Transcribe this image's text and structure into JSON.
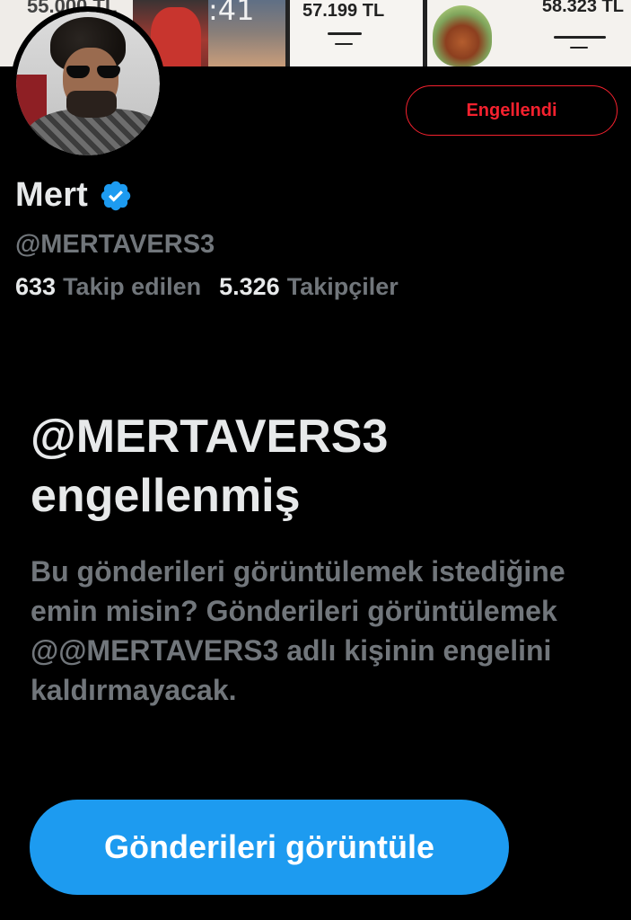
{
  "banner": {
    "price_1": "55.000 TL",
    "time_text": ":41",
    "price_2": "57.199 TL",
    "price_3": "58.323 TL"
  },
  "profile": {
    "name": "Mert",
    "verified": true,
    "verified_icon": "verified-badge-icon",
    "handle": "@MERTAVERS3",
    "following_count": "633",
    "following_label": "Takip edilen",
    "followers_count": "5.326",
    "followers_label": "Takipçiler",
    "blocked_button_label": "Engellendi"
  },
  "blocked_notice": {
    "title": "@MERTAVERS3 engellenmiş",
    "description": "Bu gönderileri görüntülemek istediğine emin misin? Gönderileri görüntülemek @@MERTAVERS3 adlı kişinin engelini kaldırmayacak.",
    "view_posts_label": "Gönderileri görüntüle"
  },
  "colors": {
    "background": "#000000",
    "primary_text": "#e7e9ea",
    "secondary_text": "#71767b",
    "accent_blue": "#1d9bf0",
    "blocked_red": "#f4212e"
  }
}
